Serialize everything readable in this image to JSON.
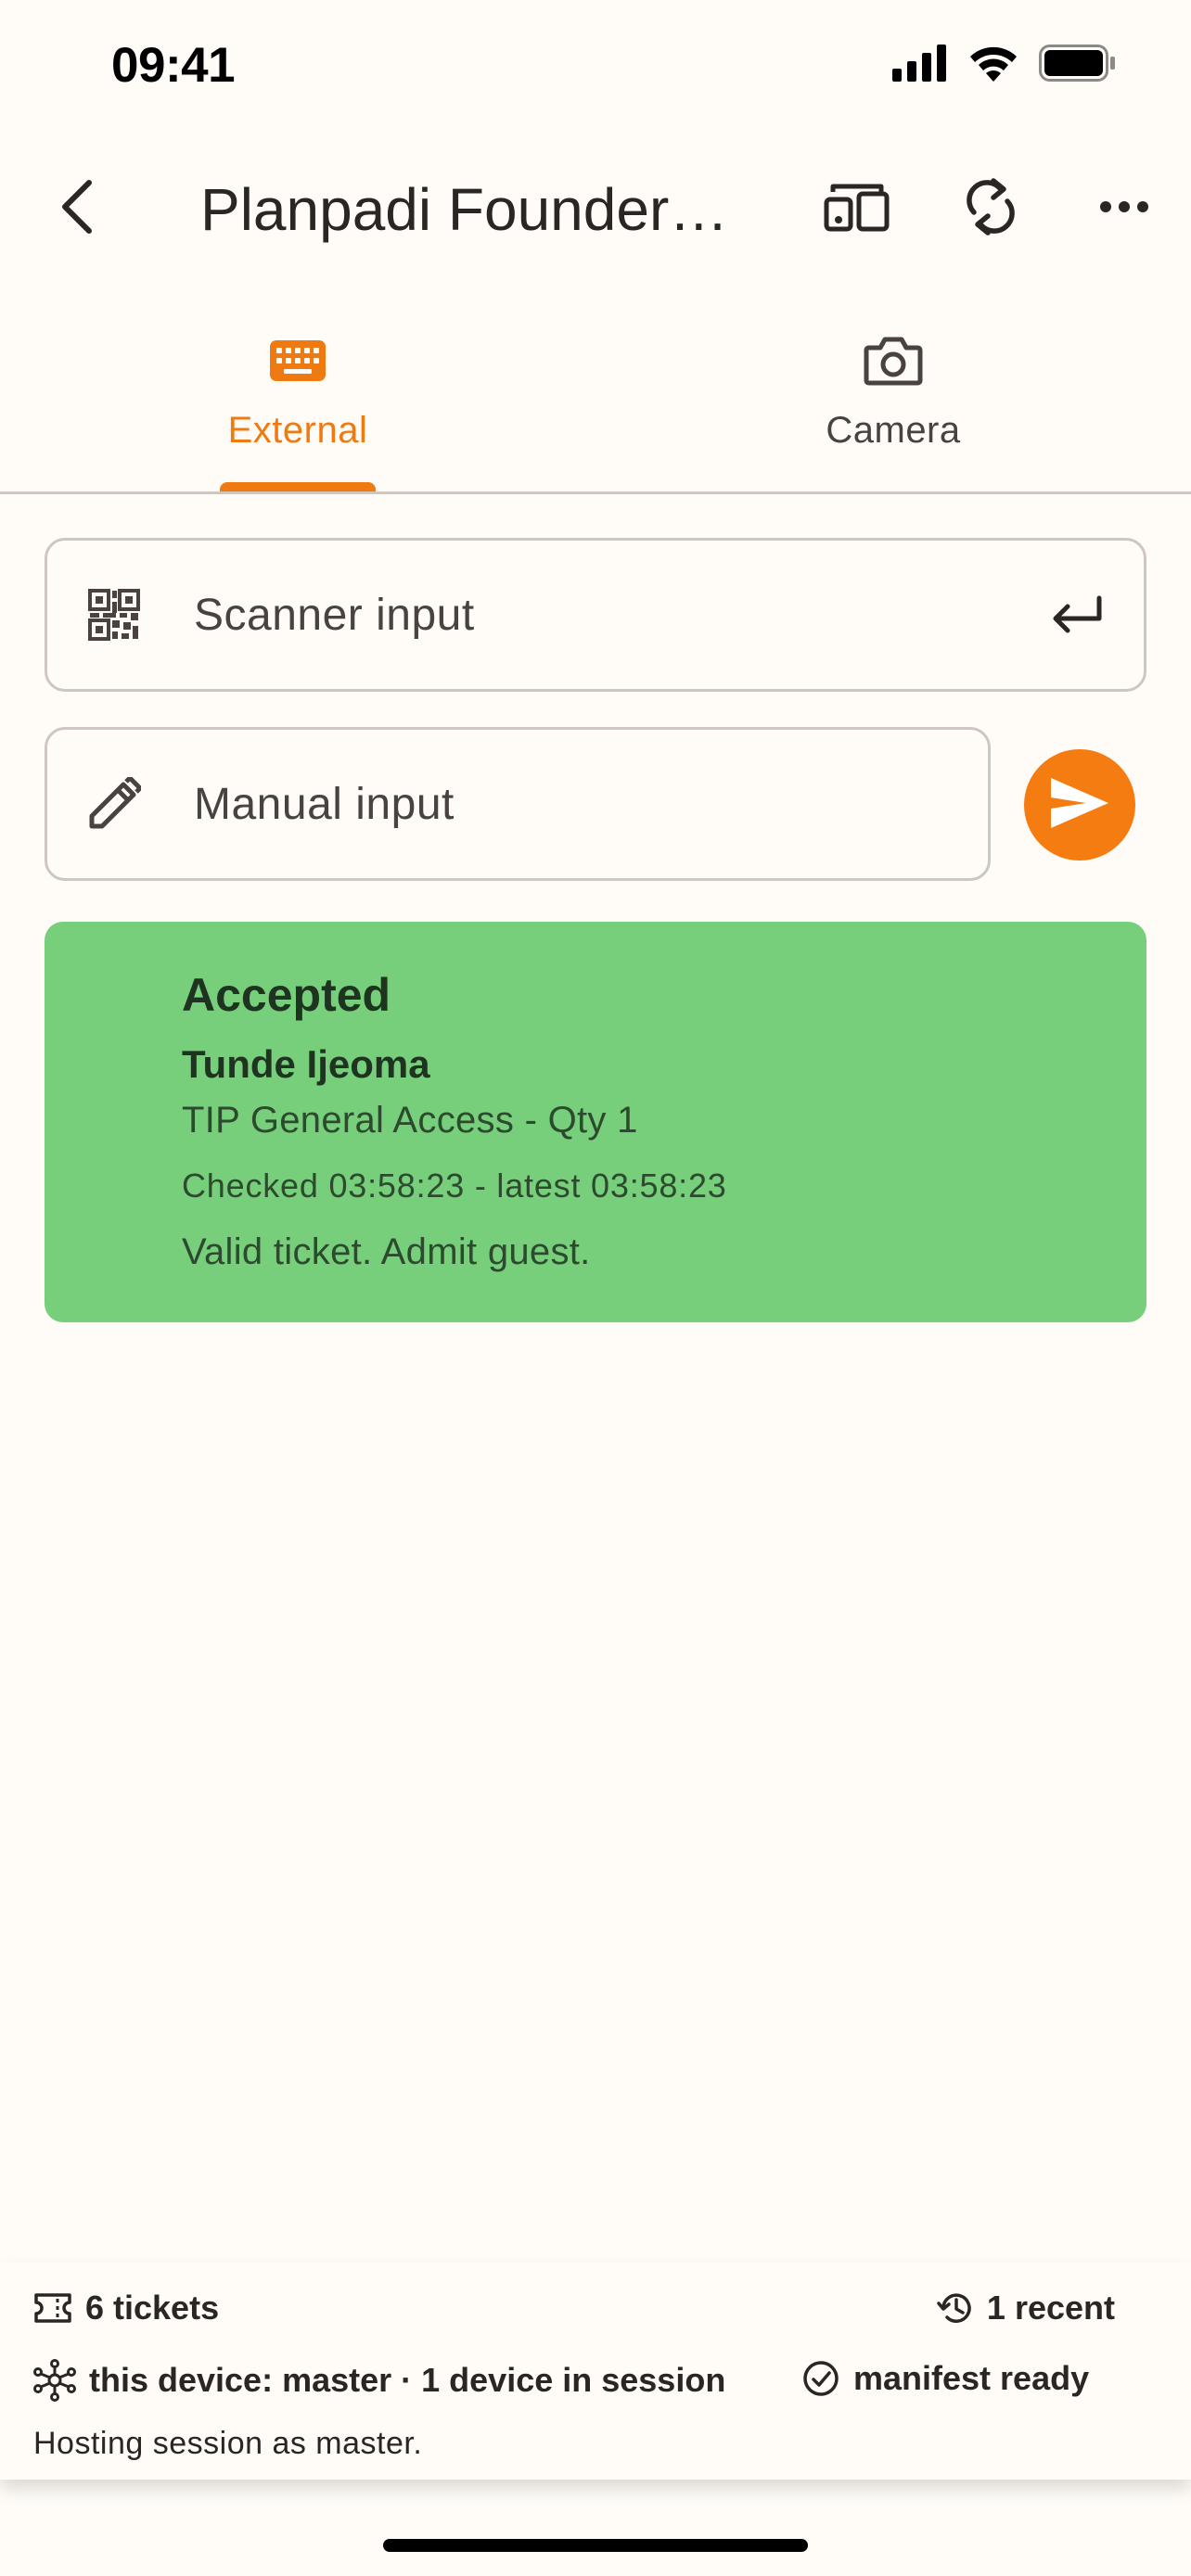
{
  "status_bar": {
    "time": "09:41",
    "icons": [
      "cellular-signal-icon",
      "wifi-icon",
      "battery-icon"
    ]
  },
  "app_bar": {
    "title": "Planpadi Founders Night",
    "icons": [
      "back-arrow-icon",
      "devices-icon",
      "sync-icon",
      "more-horizontal-icon"
    ]
  },
  "tabs": [
    {
      "label": "External",
      "icon": "keyboard-icon",
      "active": true
    },
    {
      "label": "Camera",
      "icon": "camera-icon",
      "active": false
    }
  ],
  "scanner_input": {
    "placeholder": "Scanner input",
    "value": "",
    "leading_icon": "qr-code-icon",
    "trailing_icon": "enter-key-icon"
  },
  "manual_input": {
    "placeholder": "Manual input",
    "value": "",
    "leading_icon": "pencil-icon"
  },
  "send_button": {
    "icon": "send-icon"
  },
  "result": {
    "status": "Accepted",
    "name": "Tunde Ijeoma",
    "ticket": "TIP General Access - Qty 1",
    "checked": "Checked 03:58:23 - latest 03:58:23",
    "message": "Valid ticket. Admit guest.",
    "color": "#77CF7B"
  },
  "footer": {
    "tickets": "6 tickets",
    "recent": "1 recent",
    "device": "this device: master · 1 device in session",
    "manifest": "manifest ready",
    "note": "Hosting session as master."
  },
  "colors": {
    "accent": "#F07A12",
    "background": "#FFFCF8",
    "accepted": "#77CF7B",
    "outline": "#CFC6C2"
  }
}
